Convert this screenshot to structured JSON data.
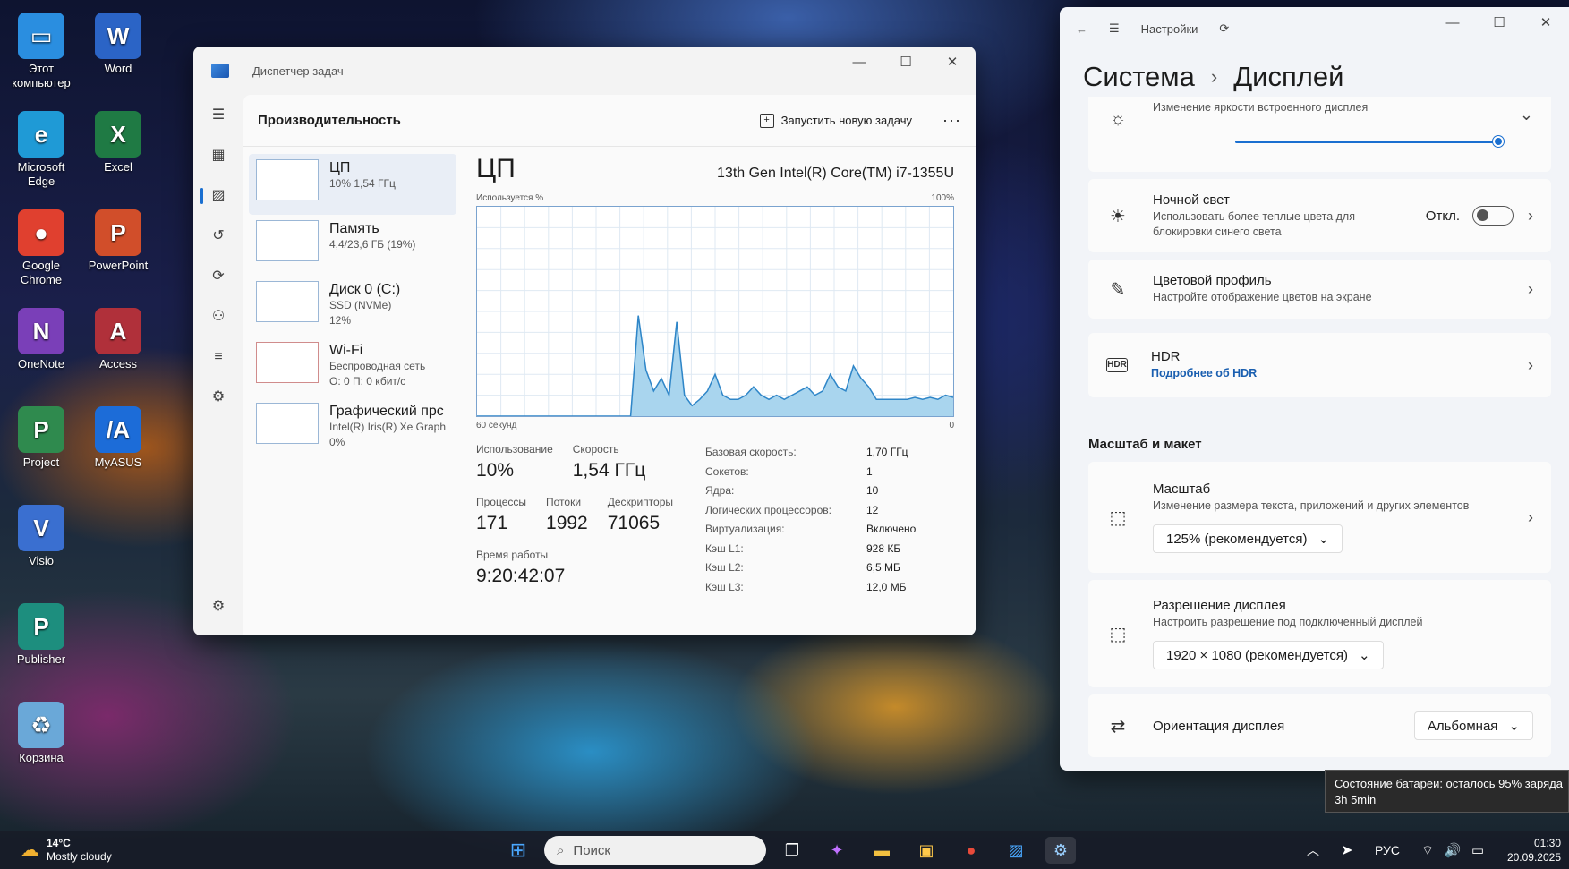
{
  "desktop": {
    "icons": [
      {
        "label": "Этот компьютер",
        "glyph": "▭",
        "color": "#2a8ee0"
      },
      {
        "label": "Word",
        "glyph": "W",
        "color": "#2b64c6"
      },
      {
        "label": "Microsoft Edge",
        "glyph": "e",
        "color": "#1f9ad6"
      },
      {
        "label": "Excel",
        "glyph": "X",
        "color": "#1f7a44"
      },
      {
        "label": "Google Chrome",
        "glyph": "●",
        "color": "#e0402f"
      },
      {
        "label": "PowerPoint",
        "glyph": "P",
        "color": "#d14e2a"
      },
      {
        "label": "OneNote",
        "glyph": "N",
        "color": "#7a3fb8"
      },
      {
        "label": "Access",
        "glyph": "A",
        "color": "#b0303a"
      },
      {
        "label": "Project",
        "glyph": "P",
        "color": "#2f8a4e"
      },
      {
        "label": "MyASUS",
        "glyph": "/A",
        "color": "#1c6cd8"
      },
      {
        "label": "Visio",
        "glyph": "V",
        "color": "#3a6fd0"
      },
      {
        "label": "Publisher",
        "glyph": "P",
        "color": "#1d8e7e"
      },
      {
        "label": "Корзина",
        "glyph": "♻",
        "color": "#6aa8d8"
      }
    ]
  },
  "taskmgr": {
    "title": "Диспетчер задач",
    "heading": "Производительность",
    "run_task": "Запустить новую задачу",
    "more": "···",
    "list": [
      {
        "name": "ЦП",
        "sub1": "10% 1,54 ГГц",
        "sub2": ""
      },
      {
        "name": "Память",
        "sub1": "4,4/23,6 ГБ (19%)",
        "sub2": ""
      },
      {
        "name": "Диск 0 (C:)",
        "sub1": "SSD (NVMe)",
        "sub2": "12%"
      },
      {
        "name": "Wi-Fi",
        "sub1": "Беспроводная сеть",
        "sub2": "О: 0 П: 0 кбит/с"
      },
      {
        "name": "Графический прс",
        "sub1": "Intel(R) Iris(R) Xe Graph",
        "sub2": "0%"
      }
    ],
    "cpu": {
      "title": "ЦП",
      "model": "13th Gen Intel(R) Core(TM) i7-1355U",
      "graph_top_left": "Используется %",
      "graph_top_right": "100%",
      "graph_bottom_left": "60 секунд",
      "graph_bottom_right": "0",
      "usage_label": "Использование",
      "usage": "10%",
      "speed_label": "Скорость",
      "speed": "1,54 ГГц",
      "proc_label": "Процессы",
      "proc": "171",
      "threads_label": "Потоки",
      "threads": "1992",
      "handles_label": "Дескрипторы",
      "handles": "71065",
      "uptime_label": "Время работы",
      "uptime": "9:20:42:07",
      "specs": [
        {
          "k": "Базовая скорость:",
          "v": "1,70 ГГц"
        },
        {
          "k": "Сокетов:",
          "v": "1"
        },
        {
          "k": "Ядра:",
          "v": "10"
        },
        {
          "k": "Логических процессоров:",
          "v": "12"
        },
        {
          "k": "Виртуализация:",
          "v": "Включено"
        },
        {
          "k": "Кэш L1:",
          "v": "928 КБ"
        },
        {
          "k": "Кэш L2:",
          "v": "6,5 МБ"
        },
        {
          "k": "Кэш L3:",
          "v": "12,0 МБ"
        }
      ]
    },
    "graph_values": [
      0,
      0,
      0,
      0,
      0,
      0,
      0,
      0,
      0,
      0,
      0,
      0,
      0,
      0,
      0,
      0,
      0,
      0,
      0,
      0,
      0,
      48,
      22,
      12,
      18,
      10,
      45,
      10,
      5,
      8,
      12,
      20,
      10,
      8,
      8,
      10,
      14,
      10,
      8,
      10,
      8,
      10,
      12,
      14,
      10,
      12,
      20,
      14,
      12,
      24,
      18,
      14,
      8,
      8,
      8,
      8,
      8,
      9,
      8,
      9,
      8,
      10,
      9
    ]
  },
  "settings": {
    "app_title": "Настройки",
    "crumb_parent": "Система",
    "crumb_current": "Дисплей",
    "brightness_text": "Изменение яркости встроенного дисплея",
    "brightness_value": 0.98,
    "night_title": "Ночной свет",
    "night_desc": "Использовать более теплые цвета для блокировки синего света",
    "night_state": "Откл.",
    "color_title": "Цветовой профиль",
    "color_desc": "Настройте отображение цветов на экране",
    "hdr_title": "HDR",
    "hdr_link": "Подробнее об HDR",
    "section_scale": "Масштаб и макет",
    "scale_title": "Масштаб",
    "scale_desc": "Изменение размера текста, приложений и других элементов",
    "scale_value": "125% (рекомендуется)",
    "res_title": "Разрешение дисплея",
    "res_desc": "Настроить разрешение под подключенный дисплей",
    "res_value": "1920 × 1080 (рекомендуется)",
    "orient_title": "Ориентация дисплея",
    "orient_value": "Альбомная"
  },
  "tooltip": {
    "line1": "Состояние батареи: осталось 95% заряда",
    "line2": "3h 5min"
  },
  "taskbar": {
    "weather_temp": "14°C",
    "weather_text": "Mostly cloudy",
    "search_placeholder": "Поиск",
    "lang": "РУС",
    "time": "01:30",
    "date": "20.09.2025"
  }
}
